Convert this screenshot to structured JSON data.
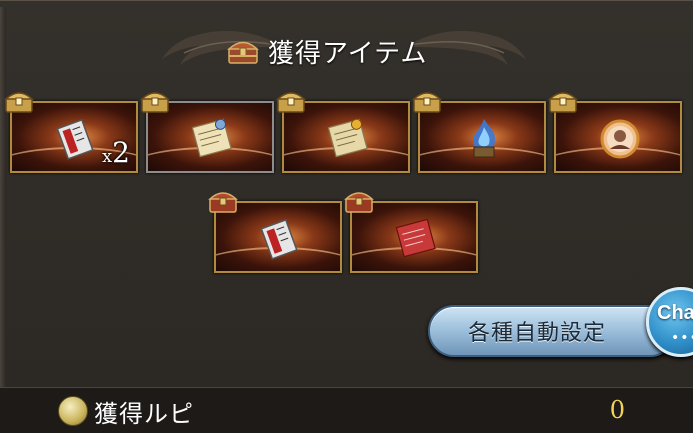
{
  "header": {
    "title": "獲得アイテム",
    "icon": "treasure-chest-icon"
  },
  "items": [
    {
      "name": "silver-ticket",
      "icon": "silver-ticket-icon",
      "count_prefix": "x",
      "count": "2",
      "chest": "gold-chest-icon"
    },
    {
      "name": "scroll-blue-seal",
      "icon": "scroll-icon",
      "count_prefix": "",
      "count": "",
      "chest": "gold-chest-icon"
    },
    {
      "name": "scroll-gold-seal",
      "icon": "scroll-icon",
      "count_prefix": "",
      "count": "",
      "chest": "gold-chest-icon"
    },
    {
      "name": "blue-flame-item",
      "icon": "blue-flame-icon",
      "count_prefix": "",
      "count": "",
      "chest": "gold-chest-icon"
    },
    {
      "name": "character-medallion",
      "icon": "medallion-icon",
      "count_prefix": "",
      "count": "",
      "chest": "gold-chest-icon"
    },
    {
      "name": "silver-ticket-2",
      "icon": "silver-ticket-icon",
      "count_prefix": "",
      "count": "",
      "chest": "red-chest-icon"
    },
    {
      "name": "red-scroll",
      "icon": "red-scroll-icon",
      "count_prefix": "",
      "count": "",
      "chest": "red-chest-icon"
    }
  ],
  "buttons": {
    "auto_settings": "各種自動設定",
    "chat": "Cha",
    "chat_dots": "•••"
  },
  "footer": {
    "label": "獲得ルピ",
    "value": "0",
    "icon": "rupie-coin-icon"
  },
  "colors": {
    "panel_bg": "#2f2b26",
    "card_border": "#b08a3e",
    "button_blue": "#9fc2de",
    "rupie_value": "#f3d35a"
  }
}
